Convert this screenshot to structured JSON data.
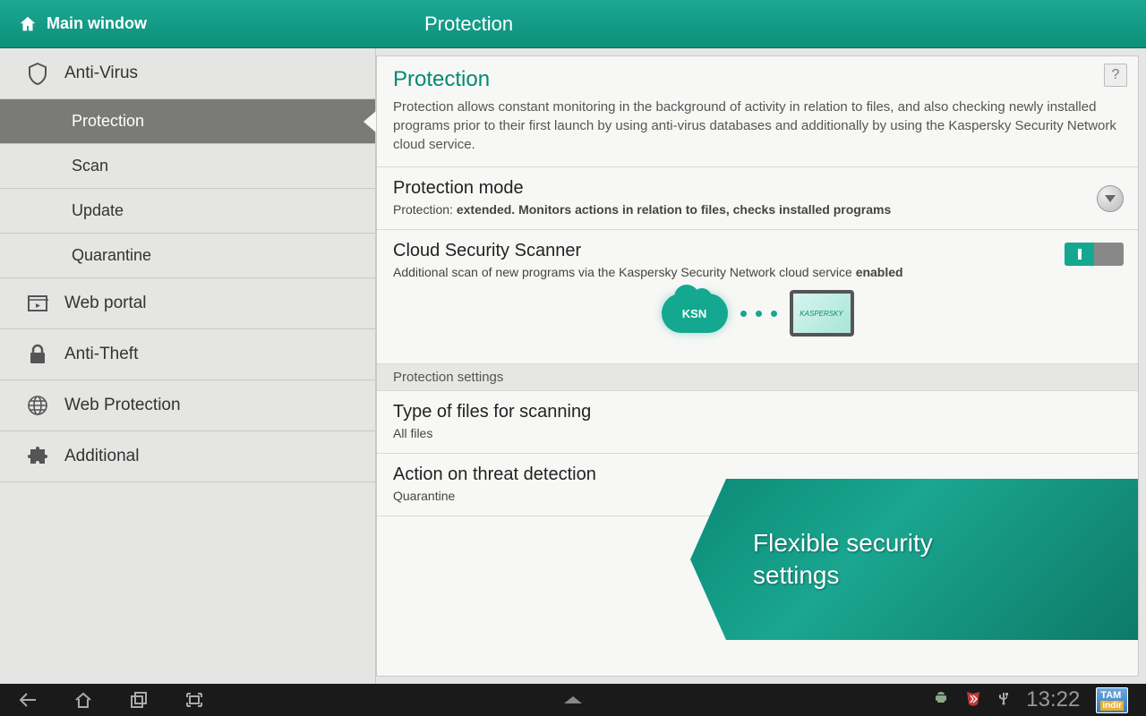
{
  "header": {
    "main_window": "Main window",
    "title": "Protection"
  },
  "sidebar": {
    "antivirus": "Anti-Virus",
    "protection": "Protection",
    "scan": "Scan",
    "update": "Update",
    "quarantine": "Quarantine",
    "web_portal": "Web portal",
    "anti_theft": "Anti-Theft",
    "web_protection": "Web Protection",
    "additional": "Additional"
  },
  "panel": {
    "title": "Protection",
    "description": "Protection allows constant monitoring in the background of activity in relation to files, and also checking newly installed programs prior to their first launch by using anti-virus databases and additionally by using the Kaspersky Security Network cloud service.",
    "help": "?"
  },
  "protection_mode": {
    "title": "Protection mode",
    "prefix": "Protection: ",
    "value": "extended. Monitors actions in relation to files, checks installed programs"
  },
  "cloud_scanner": {
    "title": "Cloud Security Scanner",
    "prefix": "Additional scan of new programs via the Kaspersky Security Network cloud service ",
    "status": "enabled",
    "cloud_label": "KSN",
    "tablet_label": "KASPERSKY"
  },
  "section_label": "Protection settings",
  "file_types": {
    "title": "Type of files for scanning",
    "value": "All files"
  },
  "action_threat": {
    "title": "Action on threat detection",
    "value": "Quarantine"
  },
  "promo": {
    "line1": "Flexible security",
    "line2": "settings"
  },
  "navbar": {
    "time": "13:22",
    "badge_top": "TAM",
    "badge_bottom": "indir"
  }
}
